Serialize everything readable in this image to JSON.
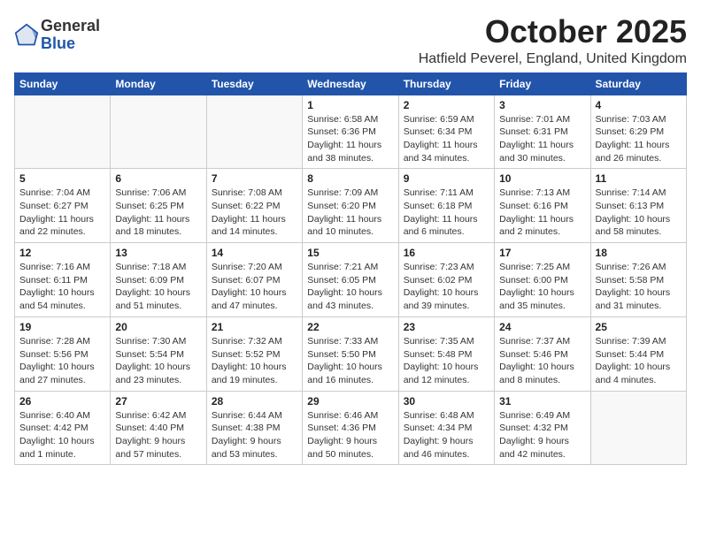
{
  "logo": {
    "general": "General",
    "blue": "Blue"
  },
  "header": {
    "month": "October 2025",
    "location": "Hatfield Peverel, England, United Kingdom"
  },
  "weekdays": [
    "Sunday",
    "Monday",
    "Tuesday",
    "Wednesday",
    "Thursday",
    "Friday",
    "Saturday"
  ],
  "weeks": [
    [
      {
        "day": "",
        "info": ""
      },
      {
        "day": "",
        "info": ""
      },
      {
        "day": "",
        "info": ""
      },
      {
        "day": "1",
        "info": "Sunrise: 6:58 AM\nSunset: 6:36 PM\nDaylight: 11 hours\nand 38 minutes."
      },
      {
        "day": "2",
        "info": "Sunrise: 6:59 AM\nSunset: 6:34 PM\nDaylight: 11 hours\nand 34 minutes."
      },
      {
        "day": "3",
        "info": "Sunrise: 7:01 AM\nSunset: 6:31 PM\nDaylight: 11 hours\nand 30 minutes."
      },
      {
        "day": "4",
        "info": "Sunrise: 7:03 AM\nSunset: 6:29 PM\nDaylight: 11 hours\nand 26 minutes."
      }
    ],
    [
      {
        "day": "5",
        "info": "Sunrise: 7:04 AM\nSunset: 6:27 PM\nDaylight: 11 hours\nand 22 minutes."
      },
      {
        "day": "6",
        "info": "Sunrise: 7:06 AM\nSunset: 6:25 PM\nDaylight: 11 hours\nand 18 minutes."
      },
      {
        "day": "7",
        "info": "Sunrise: 7:08 AM\nSunset: 6:22 PM\nDaylight: 11 hours\nand 14 minutes."
      },
      {
        "day": "8",
        "info": "Sunrise: 7:09 AM\nSunset: 6:20 PM\nDaylight: 11 hours\nand 10 minutes."
      },
      {
        "day": "9",
        "info": "Sunrise: 7:11 AM\nSunset: 6:18 PM\nDaylight: 11 hours\nand 6 minutes."
      },
      {
        "day": "10",
        "info": "Sunrise: 7:13 AM\nSunset: 6:16 PM\nDaylight: 11 hours\nand 2 minutes."
      },
      {
        "day": "11",
        "info": "Sunrise: 7:14 AM\nSunset: 6:13 PM\nDaylight: 10 hours\nand 58 minutes."
      }
    ],
    [
      {
        "day": "12",
        "info": "Sunrise: 7:16 AM\nSunset: 6:11 PM\nDaylight: 10 hours\nand 54 minutes."
      },
      {
        "day": "13",
        "info": "Sunrise: 7:18 AM\nSunset: 6:09 PM\nDaylight: 10 hours\nand 51 minutes."
      },
      {
        "day": "14",
        "info": "Sunrise: 7:20 AM\nSunset: 6:07 PM\nDaylight: 10 hours\nand 47 minutes."
      },
      {
        "day": "15",
        "info": "Sunrise: 7:21 AM\nSunset: 6:05 PM\nDaylight: 10 hours\nand 43 minutes."
      },
      {
        "day": "16",
        "info": "Sunrise: 7:23 AM\nSunset: 6:02 PM\nDaylight: 10 hours\nand 39 minutes."
      },
      {
        "day": "17",
        "info": "Sunrise: 7:25 AM\nSunset: 6:00 PM\nDaylight: 10 hours\nand 35 minutes."
      },
      {
        "day": "18",
        "info": "Sunrise: 7:26 AM\nSunset: 5:58 PM\nDaylight: 10 hours\nand 31 minutes."
      }
    ],
    [
      {
        "day": "19",
        "info": "Sunrise: 7:28 AM\nSunset: 5:56 PM\nDaylight: 10 hours\nand 27 minutes."
      },
      {
        "day": "20",
        "info": "Sunrise: 7:30 AM\nSunset: 5:54 PM\nDaylight: 10 hours\nand 23 minutes."
      },
      {
        "day": "21",
        "info": "Sunrise: 7:32 AM\nSunset: 5:52 PM\nDaylight: 10 hours\nand 19 minutes."
      },
      {
        "day": "22",
        "info": "Sunrise: 7:33 AM\nSunset: 5:50 PM\nDaylight: 10 hours\nand 16 minutes."
      },
      {
        "day": "23",
        "info": "Sunrise: 7:35 AM\nSunset: 5:48 PM\nDaylight: 10 hours\nand 12 minutes."
      },
      {
        "day": "24",
        "info": "Sunrise: 7:37 AM\nSunset: 5:46 PM\nDaylight: 10 hours\nand 8 minutes."
      },
      {
        "day": "25",
        "info": "Sunrise: 7:39 AM\nSunset: 5:44 PM\nDaylight: 10 hours\nand 4 minutes."
      }
    ],
    [
      {
        "day": "26",
        "info": "Sunrise: 6:40 AM\nSunset: 4:42 PM\nDaylight: 10 hours\nand 1 minute."
      },
      {
        "day": "27",
        "info": "Sunrise: 6:42 AM\nSunset: 4:40 PM\nDaylight: 9 hours\nand 57 minutes."
      },
      {
        "day": "28",
        "info": "Sunrise: 6:44 AM\nSunset: 4:38 PM\nDaylight: 9 hours\nand 53 minutes."
      },
      {
        "day": "29",
        "info": "Sunrise: 6:46 AM\nSunset: 4:36 PM\nDaylight: 9 hours\nand 50 minutes."
      },
      {
        "day": "30",
        "info": "Sunrise: 6:48 AM\nSunset: 4:34 PM\nDaylight: 9 hours\nand 46 minutes."
      },
      {
        "day": "31",
        "info": "Sunrise: 6:49 AM\nSunset: 4:32 PM\nDaylight: 9 hours\nand 42 minutes."
      },
      {
        "day": "",
        "info": ""
      }
    ]
  ]
}
